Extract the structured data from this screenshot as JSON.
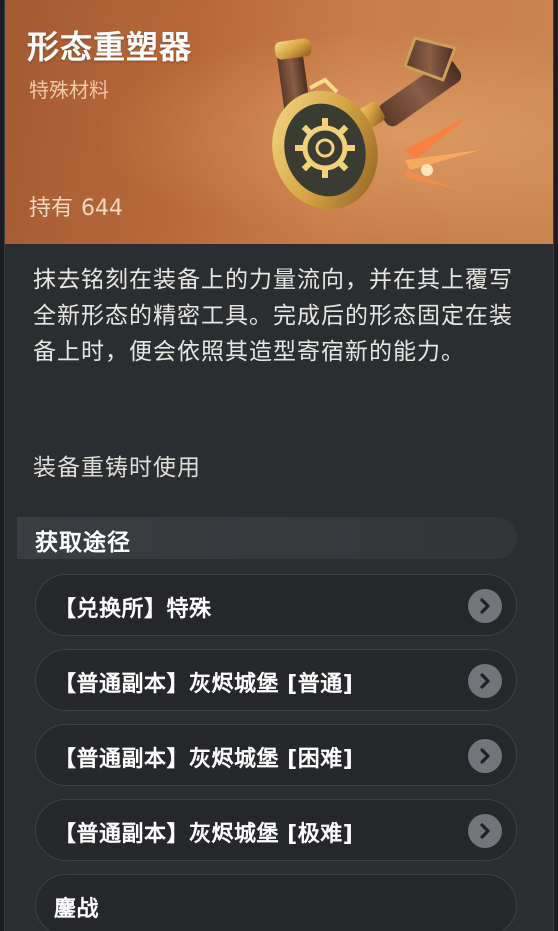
{
  "item": {
    "title": "形态重塑器",
    "category": "特殊材料",
    "owned_label": "持有",
    "owned_count": "644"
  },
  "description": "抹去铭刻在装备上的力量流向，并在其上覆写全新形态的精密工具。完成后的形态固定在装备上时，便会依照其造型寄宿新的能力。",
  "usage": "装备重铸时使用",
  "acquire": {
    "title": "获取途径",
    "sources": [
      {
        "label": "【兑换所】特殊"
      },
      {
        "label": "【普通副本】灰烬城堡 [普通]"
      },
      {
        "label": "【普通副本】灰烬城堡 [困难]"
      },
      {
        "label": "【普通副本】灰烬城堡 [极难]"
      },
      {
        "label": "鏖战"
      }
    ]
  },
  "colors": {
    "header_bg": "#b8693a",
    "panel_bg": "#2b2e31",
    "row_bg": "#25272a",
    "go_button": "#72767b"
  },
  "icons": {
    "item_image": "gear-emblem-tool-icon",
    "go": "chevron-right-icon"
  }
}
